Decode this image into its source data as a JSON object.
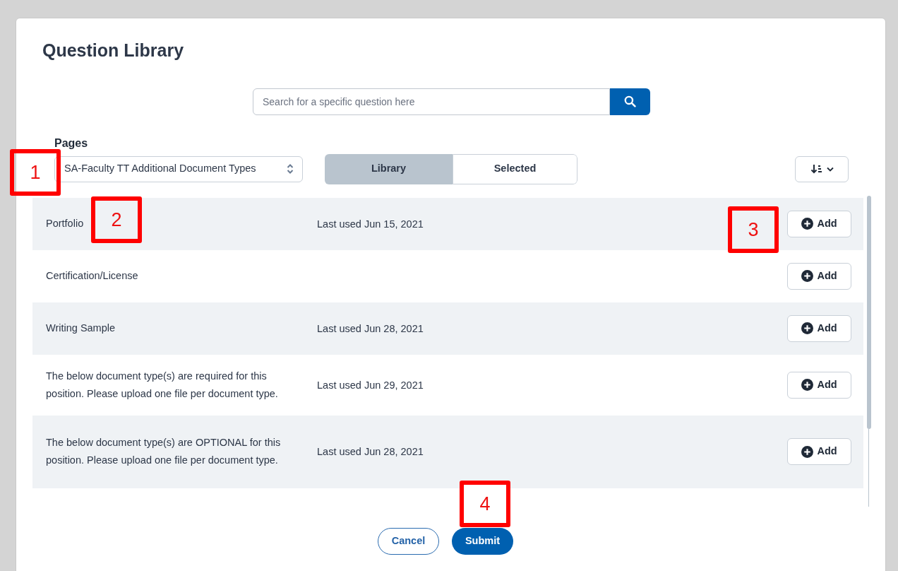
{
  "title": "Question Library",
  "search": {
    "placeholder": "Search for a specific question here"
  },
  "pages": {
    "label": "Pages",
    "value": "SA-Faculty TT Additional Document Types"
  },
  "tabs": [
    {
      "label": "Library",
      "selected": true
    },
    {
      "label": "Selected",
      "selected": false
    }
  ],
  "rows": [
    {
      "name": "Portfolio",
      "last_used": "Last used Jun 15, 2021",
      "action": "Add"
    },
    {
      "name": "Certification/License",
      "action": "Add"
    },
    {
      "name": "Writing Sample",
      "last_used": "Last used Jun 28, 2021",
      "action": "Add"
    },
    {
      "name": "The below document type(s) are required for this position. Please upload one file per document type.",
      "last_used": "Last used Jun 29, 2021",
      "action": "Add"
    },
    {
      "name": "The below document type(s) are OPTIONAL for this position. Please upload one file per document type.",
      "last_used": "Last used Jun 28, 2021",
      "action": "Add"
    }
  ],
  "footer": {
    "cancel": "Cancel",
    "submit": "Submit"
  },
  "callouts": [
    "1",
    "2",
    "3",
    "4"
  ]
}
